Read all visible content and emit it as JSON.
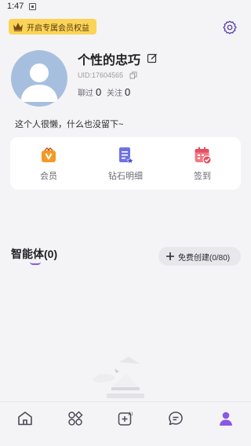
{
  "status_bar": {
    "time": "1:47"
  },
  "vip_banner": {
    "label": "开启专属会员权益",
    "bg_color": "#fbd457"
  },
  "profile": {
    "name": "个性的忠巧",
    "uid": "UID:17604565",
    "stats": [
      {
        "label": "聊过",
        "value": "0"
      },
      {
        "label": "关注",
        "value": "0"
      }
    ],
    "bio": "这个人很懒，什么也没留下~"
  },
  "quick_actions": [
    {
      "label": "会员",
      "icon": "vip-bag-icon"
    },
    {
      "label": "钻石明细",
      "icon": "diamond-detail-icon"
    },
    {
      "label": "签到",
      "icon": "calendar-check-icon"
    }
  ],
  "agents": {
    "title": "智能体(0)",
    "create_label": "免费创建(0/80)"
  },
  "tab_bar": [
    {
      "icon": "home-icon",
      "active": false
    },
    {
      "icon": "discover-icon",
      "active": false
    },
    {
      "icon": "ai-create-icon",
      "active": false
    },
    {
      "icon": "chat-icon",
      "active": false
    },
    {
      "icon": "profile-icon",
      "active": true
    }
  ],
  "colors": {
    "accent": "#8a56e8",
    "background": "#f4f4f7",
    "card": "#ffffff"
  }
}
